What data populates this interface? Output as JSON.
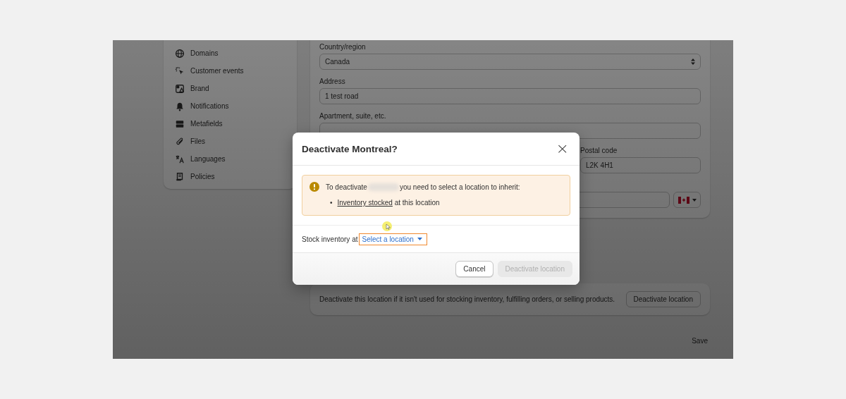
{
  "sidebar": {
    "items": [
      {
        "label": "Domains"
      },
      {
        "label": "Customer events"
      },
      {
        "label": "Brand"
      },
      {
        "label": "Notifications"
      },
      {
        "label": "Metafields"
      },
      {
        "label": "Files"
      },
      {
        "label": "Languages"
      },
      {
        "label": "Policies"
      }
    ]
  },
  "form": {
    "country": {
      "label": "Country/region",
      "value": "Canada"
    },
    "address": {
      "label": "Address",
      "value": "1 test road"
    },
    "apartment": {
      "label": "Apartment, suite, etc."
    },
    "postal_code": {
      "label": "Postal code",
      "value": "L2K 4H1"
    }
  },
  "deactivate_card": {
    "text": "Deactivate this location if it isn't used for stocking inventory, fulfilling orders, or selling products.",
    "button": "Deactivate location"
  },
  "save_button": "Save",
  "dialog": {
    "title": "Deactivate Montreal?",
    "close": "×",
    "warning": {
      "before": "To deactivate",
      "after": "you need to select a location to inherit:",
      "bullets": [
        {
          "marker": "•",
          "link": "Inventory stocked",
          "rest": "at this location"
        }
      ]
    },
    "stock_label": "Stock inventory at",
    "location_select": {
      "label": "Select a location",
      "focused": true
    },
    "buttons": [
      {
        "label": "Cancel",
        "disabled": false
      },
      {
        "label": "Deactivate location",
        "disabled": true
      }
    ]
  }
}
